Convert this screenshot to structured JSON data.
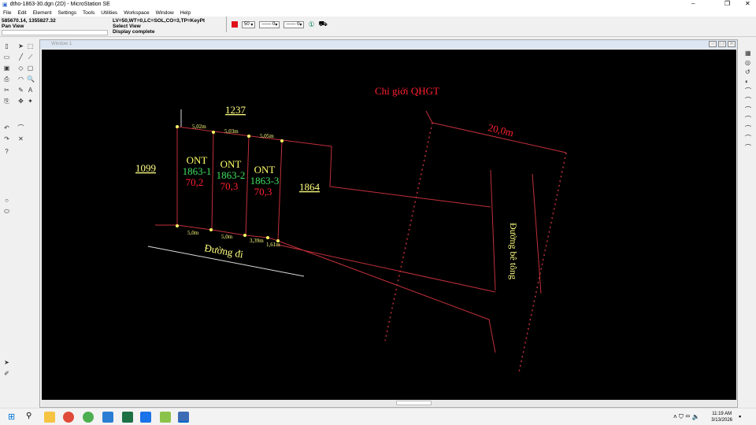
{
  "window": {
    "title": "dtho-1863-30.dgn (2D) - MicroStation SE",
    "minimize": "–",
    "maximize": "❐",
    "close": "✕"
  },
  "menu": [
    "File",
    "Edit",
    "Element",
    "Settings",
    "Tools",
    "Utilities",
    "Workspace",
    "Window",
    "Help"
  ],
  "status": {
    "coords": "585670.14, 1355827.32",
    "mode": "Pan View",
    "attributes": "LV=50,WT=0,LC=SOL,CO=3,TP=KeyPt",
    "prompt": "Select View",
    "message": "Display complete",
    "color_hex": "#e0101a",
    "level": "50",
    "style": "0",
    "weight": "0"
  },
  "view_window": {
    "title": "Window 1"
  },
  "drawing": {
    "parcel_labels": [
      "1237",
      "1099",
      "1864"
    ],
    "lots": [
      {
        "type": "ONT",
        "id": "1863-1",
        "area": "70,2"
      },
      {
        "type": "ONT",
        "id": "1863-2",
        "area": "70,3"
      },
      {
        "type": "ONT",
        "id": "1863-3",
        "area": "70,3"
      }
    ],
    "top_dims": [
      "5,02m",
      "5,03m",
      "5,05m"
    ],
    "bottom_dims": [
      "5,0m",
      "5,0m",
      "3,39m",
      "1,61m"
    ],
    "road_label": "Đường đi",
    "concrete_road_label": "Đường bê tông",
    "planning_line_label": "Chỉ giới QHGT",
    "planning_distance": "20,0m",
    "colors": {
      "background": "#000000",
      "boundary": "#c0303a",
      "type": "#ffff66",
      "lot_id": "#40e060",
      "area": "#ff2030",
      "label": "#ffff80"
    }
  },
  "taskbar": {
    "time": "11:19 AM",
    "date": "3/13/2026"
  }
}
